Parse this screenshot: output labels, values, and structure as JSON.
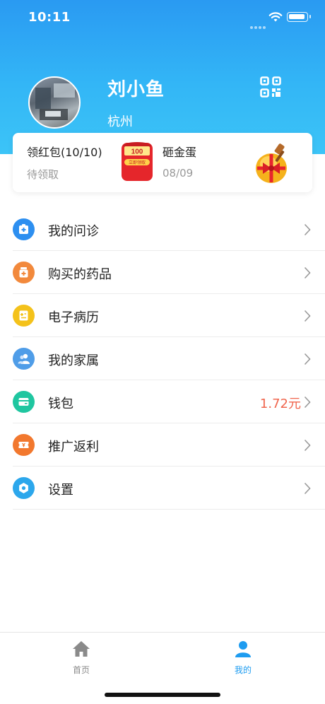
{
  "status_bar": {
    "time": "10:11"
  },
  "profile": {
    "name": "刘小鱼",
    "city": "杭州"
  },
  "promo": {
    "red_packet": {
      "title": "领红包(10/10)",
      "subtitle": "待领取",
      "badge_amount": "100",
      "badge_text": "立即领取"
    },
    "golden_egg": {
      "title": "砸金蛋",
      "subtitle": "08/09"
    }
  },
  "menu": [
    {
      "label": "我的问诊",
      "icon": "consultation-icon",
      "color": "#2d8ff0",
      "value": ""
    },
    {
      "label": "购买的药品",
      "icon": "medicine-icon",
      "color": "#f2893c",
      "value": ""
    },
    {
      "label": "电子病历",
      "icon": "record-icon",
      "color": "#f4c21b",
      "value": ""
    },
    {
      "label": "我的家属",
      "icon": "family-icon",
      "color": "#4f9de8",
      "value": ""
    },
    {
      "label": "钱包",
      "icon": "wallet-icon",
      "color": "#1fc6a0",
      "value": "1.72元"
    },
    {
      "label": "推广返利",
      "icon": "rebate-icon",
      "color": "#f2782e",
      "value": ""
    },
    {
      "label": "设置",
      "icon": "settings-icon",
      "color": "#2ca7ec",
      "value": ""
    }
  ],
  "tabbar": [
    {
      "label": "首页",
      "color": "#8a8a8a"
    },
    {
      "label": "我的",
      "color": "#1e9cf0"
    }
  ]
}
